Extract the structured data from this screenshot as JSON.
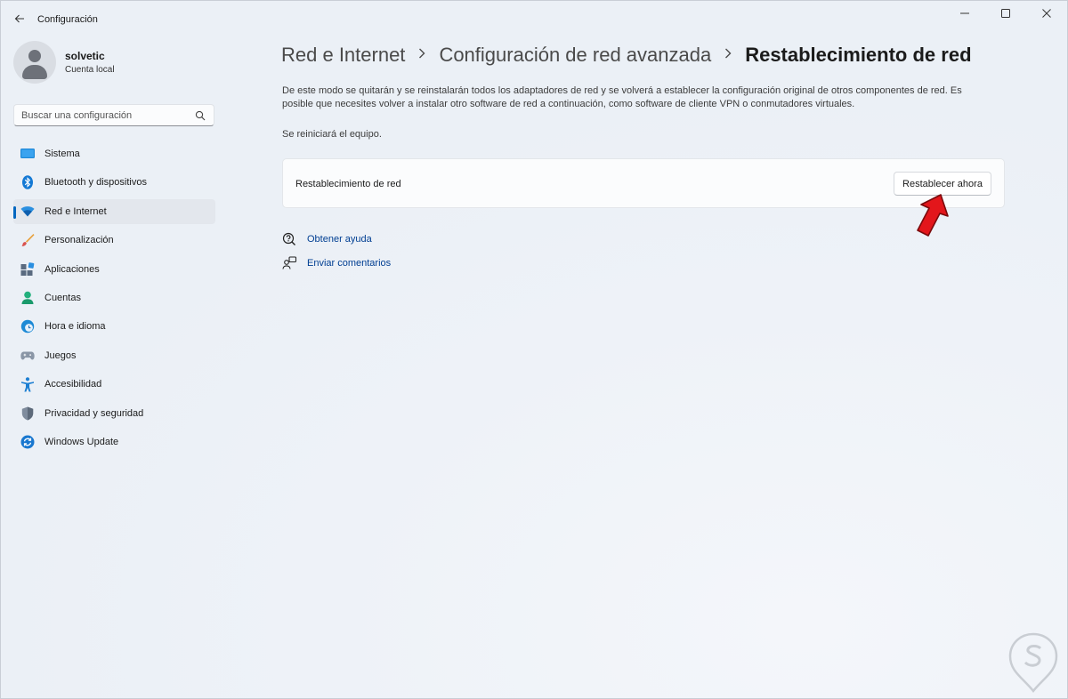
{
  "window": {
    "title": "Configuración",
    "controls": [
      "minimize",
      "maximize",
      "close"
    ]
  },
  "profile": {
    "name": "solvetic",
    "account_type": "Cuenta local"
  },
  "search": {
    "placeholder": "Buscar una configuración"
  },
  "sidebar": {
    "items": [
      {
        "label": "Sistema",
        "icon": "system-icon",
        "active": false
      },
      {
        "label": "Bluetooth y dispositivos",
        "icon": "bluetooth-icon",
        "active": false
      },
      {
        "label": "Red e Internet",
        "icon": "wifi-icon",
        "active": true
      },
      {
        "label": "Personalización",
        "icon": "brush-icon",
        "active": false
      },
      {
        "label": "Aplicaciones",
        "icon": "apps-icon",
        "active": false
      },
      {
        "label": "Cuentas",
        "icon": "accounts-icon",
        "active": false
      },
      {
        "label": "Hora e idioma",
        "icon": "time-language-icon",
        "active": false
      },
      {
        "label": "Juegos",
        "icon": "gamepad-icon",
        "active": false
      },
      {
        "label": "Accesibilidad",
        "icon": "accessibility-icon",
        "active": false
      },
      {
        "label": "Privacidad y seguridad",
        "icon": "shield-icon",
        "active": false
      },
      {
        "label": "Windows Update",
        "icon": "update-icon",
        "active": false
      }
    ]
  },
  "breadcrumb": {
    "items": [
      "Red e Internet",
      "Configuración de red avanzada"
    ],
    "current": "Restablecimiento de red"
  },
  "main": {
    "description": "De este modo se quitarán y se reinstalarán todos los adaptadores de red y se volverá a establecer la configuración original de otros componentes de red. Es posible que necesites volver a instalar otro software de red a continuación, como software de cliente VPN o conmutadores virtuales.",
    "note": "Se reiniciará el equipo.",
    "card": {
      "label": "Restablecimiento de red",
      "button_label": "Restablecer ahora"
    },
    "links": {
      "help": "Obtener ayuda",
      "feedback": "Enviar comentarios"
    }
  },
  "colors": {
    "accent": "#0067c0",
    "link": "#003e92",
    "arrow": "#e3161b"
  }
}
